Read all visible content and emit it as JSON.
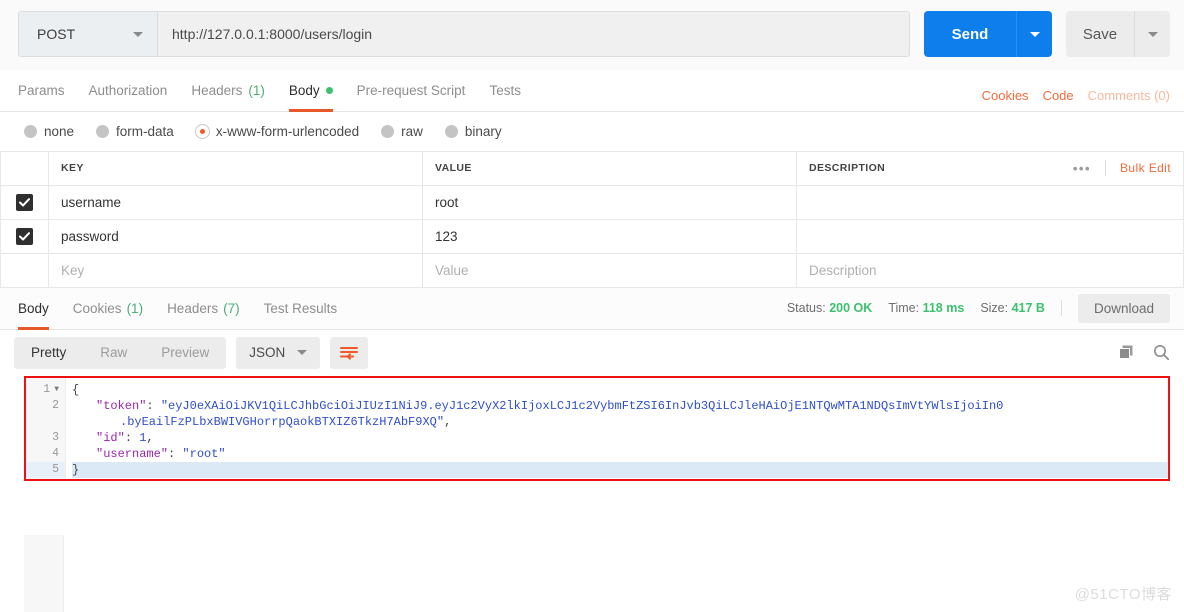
{
  "request": {
    "method": "POST",
    "url": "http://127.0.0.1:8000/users/login",
    "send_label": "Send",
    "save_label": "Save",
    "tabs": [
      {
        "label": "Params",
        "count": "",
        "active": false,
        "dot": false
      },
      {
        "label": "Authorization",
        "count": "",
        "active": false,
        "dot": false
      },
      {
        "label": "Headers",
        "count": "(1)",
        "active": false,
        "dot": false
      },
      {
        "label": "Body",
        "count": "",
        "active": true,
        "dot": true
      },
      {
        "label": "Pre-request Script",
        "count": "",
        "active": false,
        "dot": false
      },
      {
        "label": "Tests",
        "count": "",
        "active": false,
        "dot": false
      }
    ],
    "links": {
      "cookies": "Cookies",
      "code": "Code",
      "comments": "Comments (0)"
    },
    "body_types": [
      {
        "label": "none",
        "selected": false
      },
      {
        "label": "form-data",
        "selected": false
      },
      {
        "label": "x-www-form-urlencoded",
        "selected": true
      },
      {
        "label": "raw",
        "selected": false
      },
      {
        "label": "binary",
        "selected": false
      }
    ],
    "table": {
      "headers": {
        "key": "KEY",
        "value": "VALUE",
        "description": "DESCRIPTION"
      },
      "options_icon": "•••",
      "bulk_edit": "Bulk Edit",
      "rows": [
        {
          "checked": true,
          "key": "username",
          "value": "root",
          "description": ""
        },
        {
          "checked": true,
          "key": "password",
          "value": "123",
          "description": ""
        }
      ],
      "placeholder_row": {
        "key": "Key",
        "value": "Value",
        "description": "Description"
      }
    }
  },
  "response": {
    "tabs": [
      {
        "label": "Body",
        "count": "",
        "active": true
      },
      {
        "label": "Cookies",
        "count": "(1)",
        "active": false
      },
      {
        "label": "Headers",
        "count": "(7)",
        "active": false
      },
      {
        "label": "Test Results",
        "count": "",
        "active": false
      }
    ],
    "meta": {
      "status_label": "Status:",
      "status_value": "200 OK",
      "time_label": "Time:",
      "time_value": "118 ms",
      "size_label": "Size:",
      "size_value": "417 B"
    },
    "download_label": "Download",
    "view_modes": [
      {
        "label": "Pretty",
        "active": true
      },
      {
        "label": "Raw",
        "active": false
      },
      {
        "label": "Preview",
        "active": false
      }
    ],
    "format": "JSON",
    "icons": {
      "wrap": "word-wrap-icon",
      "copy": "copy-icon",
      "search": "search-icon"
    },
    "body": {
      "lines": [
        {
          "num": "1",
          "foldable": true,
          "highlight": false,
          "indent": 0,
          "tokens": [
            {
              "t": "{",
              "c": "p"
            }
          ]
        },
        {
          "num": "2",
          "foldable": false,
          "highlight": false,
          "indent": 1,
          "tokens": [
            {
              "t": "\"token\"",
              "c": "k"
            },
            {
              "t": ": ",
              "c": "p"
            },
            {
              "t": "\"eyJ0eXAiOiJKV1QiLCJhbGciOiJIUzI1NiJ9.eyJ1c2VyX2lkIjoxLCJ1c2VybmFtZSI6InJvb3QiLCJleHAiOjE1NTQwMTA1NDQsImVtYWlsIjoiIn0",
              "c": "s"
            }
          ]
        },
        {
          "num": "",
          "foldable": false,
          "highlight": false,
          "indent": 2,
          "tokens": [
            {
              "t": ".byEailFzPLbxBWIVGHorrpQaokBTXIZ6TkzH7AbF9XQ\"",
              "c": "s"
            },
            {
              "t": ",",
              "c": "p"
            }
          ]
        },
        {
          "num": "3",
          "foldable": false,
          "highlight": false,
          "indent": 1,
          "tokens": [
            {
              "t": "\"id\"",
              "c": "k"
            },
            {
              "t": ": ",
              "c": "p"
            },
            {
              "t": "1",
              "c": "n"
            },
            {
              "t": ",",
              "c": "p"
            }
          ]
        },
        {
          "num": "4",
          "foldable": false,
          "highlight": false,
          "indent": 1,
          "tokens": [
            {
              "t": "\"username\"",
              "c": "k"
            },
            {
              "t": ": ",
              "c": "p"
            },
            {
              "t": "\"root\"",
              "c": "s"
            }
          ]
        },
        {
          "num": "5",
          "foldable": false,
          "highlight": true,
          "indent": 0,
          "tokens": [
            {
              "t": "}",
              "c": "p"
            }
          ]
        }
      ]
    }
  },
  "watermark": "@51CTO博客"
}
